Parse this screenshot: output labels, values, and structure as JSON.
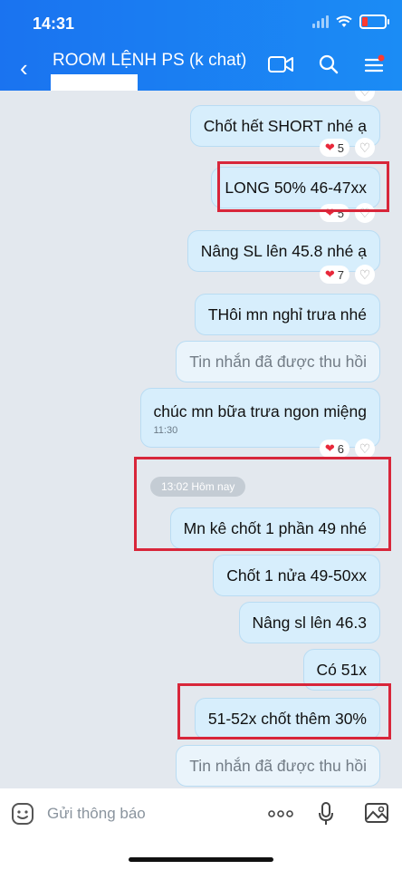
{
  "status_bar": {
    "time": "14:31"
  },
  "header": {
    "title": "ROOM LỆNH PS (k chat)"
  },
  "messages": [
    {
      "text": "Chốt hết SHORT nhé ạ",
      "reaction_count": "5"
    },
    {
      "text": "LONG 50% 46-47xx",
      "reaction_count": "5"
    },
    {
      "text": "Nâng SL lên 45.8 nhé ạ",
      "reaction_count": "7"
    },
    {
      "text": "THôi mn nghỉ trưa nhé"
    },
    {
      "text": "Tin nhắn đã được thu hồi"
    },
    {
      "text": "chúc mn bữa trưa ngon miệng",
      "time": "11:30",
      "reaction_count": "6"
    },
    {
      "text": "Mn kê chốt 1 phần 49 nhé"
    },
    {
      "text": "Chốt 1 nửa 49-50xx"
    },
    {
      "text": "Nâng sl lên 46.3"
    },
    {
      "text": "Có 51x"
    },
    {
      "text": "51-52x chốt thêm 30%"
    },
    {
      "text": "Tin nhắn đã được thu hồi"
    }
  ],
  "divider": {
    "label": "13:02 Hôm nay"
  },
  "composer": {
    "placeholder": "Gửi thông báo"
  },
  "colors": {
    "header": "#1a73f0",
    "bubble": "#d7eefc",
    "highlight": "#d8263a",
    "heart": "#e8283a"
  }
}
